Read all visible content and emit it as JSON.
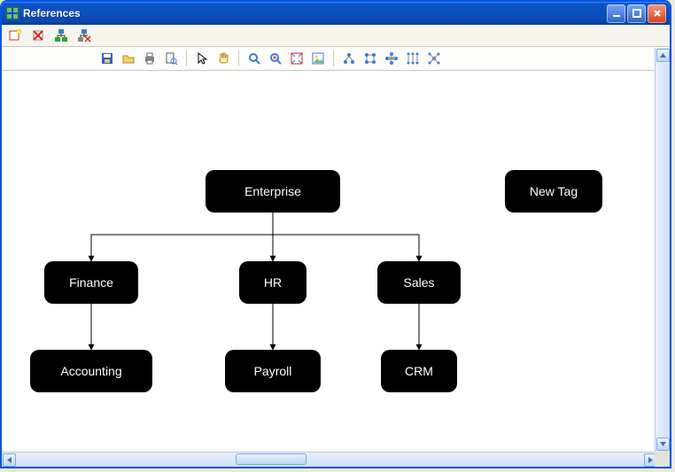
{
  "window": {
    "title": "References"
  },
  "nodes": {
    "enterprise": "Enterprise",
    "finance": "Finance",
    "hr": "HR",
    "sales": "Sales",
    "accounting": "Accounting",
    "payroll": "Payroll",
    "crm": "CRM",
    "newtag": "New Tag"
  }
}
